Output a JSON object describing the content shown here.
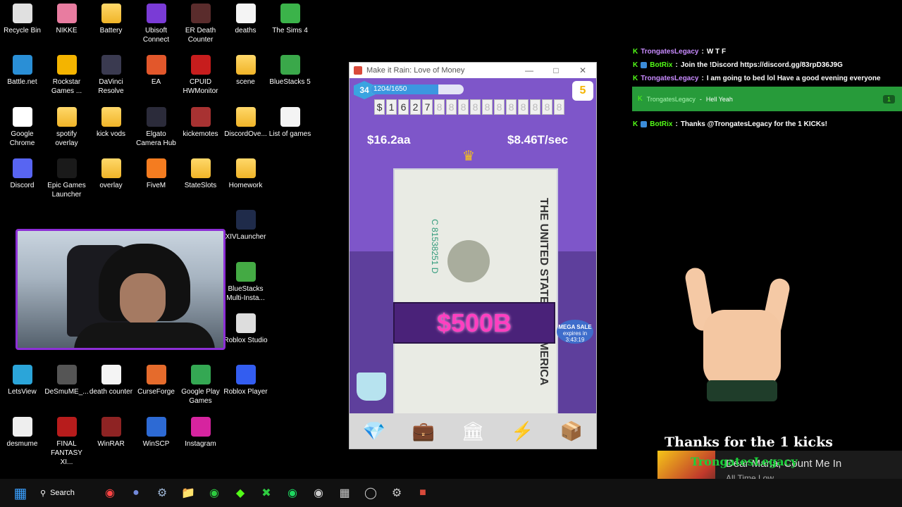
{
  "desktop": {
    "icons": [
      {
        "label": "Recycle Bin"
      },
      {
        "label": "NIKKE"
      },
      {
        "label": "Battery"
      },
      {
        "label": "Ubisoft Connect"
      },
      {
        "label": "ER Death Counter"
      },
      {
        "label": "deaths"
      },
      {
        "label": "The Sims 4"
      },
      {
        "label": "Battle.net"
      },
      {
        "label": "Rockstar Games ..."
      },
      {
        "label": "DaVinci Resolve"
      },
      {
        "label": "EA"
      },
      {
        "label": "CPUID HWMonitor"
      },
      {
        "label": "scene"
      },
      {
        "label": "BlueStacks 5"
      },
      {
        "label": "Google Chrome"
      },
      {
        "label": "spotify overlay"
      },
      {
        "label": "kick vods"
      },
      {
        "label": "Elgato Camera Hub"
      },
      {
        "label": "kickemotes"
      },
      {
        "label": "DiscordOve..."
      },
      {
        "label": "List of games"
      },
      {
        "label": "Discord"
      },
      {
        "label": "Epic Games Launcher"
      },
      {
        "label": "overlay"
      },
      {
        "label": "FiveM"
      },
      {
        "label": "StateSlots"
      },
      {
        "label": "Homework"
      },
      {
        "label": "XIVLauncher"
      },
      {
        "label": "BlueStacks Multi-Insta..."
      },
      {
        "label": "Roblox Studio"
      },
      {
        "label": "LetsView"
      },
      {
        "label": "DeSmuME_..."
      },
      {
        "label": "death counter"
      },
      {
        "label": "CurseForge"
      },
      {
        "label": "Google Play Games"
      },
      {
        "label": "Roblox Player"
      },
      {
        "label": "desmume"
      },
      {
        "label": "FINAL FANTASY XI..."
      },
      {
        "label": "WinRAR"
      },
      {
        "label": "WinSCP"
      },
      {
        "label": "Instagram"
      }
    ]
  },
  "game": {
    "window_title": "Make it Rain: Love of Money",
    "level": "34",
    "xp_text": "1204/1650",
    "xp_fraction": 0.73,
    "coins": "5",
    "counter_digits": [
      "$",
      "1",
      "6",
      "2",
      "7",
      "8",
      "8",
      "8",
      "8",
      "8",
      "8",
      "8",
      "8",
      "8",
      "8",
      "8"
    ],
    "balance": "$16.2aa",
    "rate": "$8.46T/sec",
    "banner_amount": "$500B",
    "sale_label": "MEGA SALE",
    "sale_sub": "expires in",
    "sale_timer": "3:43:19",
    "bill_serial": "C 81538251 D",
    "bill_text": "THE UNITED STATES OF AMERICA"
  },
  "chat": {
    "messages": [
      {
        "user": "TrongatesLegacy",
        "text": "W  T  F"
      },
      {
        "user": "BotRix",
        "text": "Join the !Discord https://discord.gg/83rpD36J9G"
      },
      {
        "user": "TrongatesLegacy",
        "text": "I am going to bed lol Have a good evening everyone"
      },
      {
        "user": "BotRix",
        "text": "Thanks @TrongatesLegacy for the 1 KICKs!"
      }
    ],
    "highlight": {
      "user": "TrongatesLegacy",
      "text": "Hell Yeah",
      "count": "1"
    }
  },
  "alert": {
    "thanks_text": "Thanks for the 1 kicks",
    "overlay_name": "TrongatesLegacy"
  },
  "now_playing": {
    "title": "Dear Maria, Count Me In",
    "artist": "All Time Low",
    "progress": 0.18
  },
  "taskbar": {
    "search_label": "Search"
  }
}
